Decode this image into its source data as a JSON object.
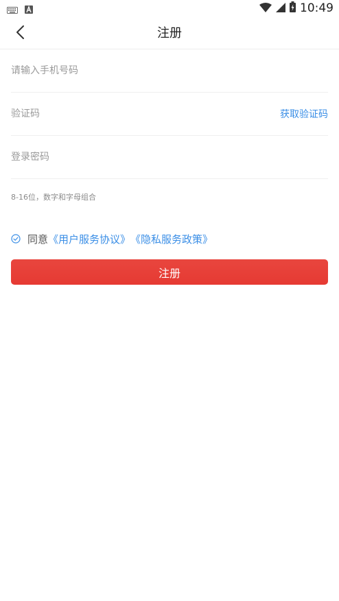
{
  "status_bar": {
    "time": "10:49",
    "icons": [
      "keyboard-icon",
      "a-icon",
      "wifi-icon",
      "signal-icon",
      "battery-icon"
    ]
  },
  "header": {
    "title": "注册",
    "back_icon": "chevron-left-icon"
  },
  "form": {
    "phone_placeholder": "请输入手机号码",
    "phone_value": "",
    "code_placeholder": "验证码",
    "code_value": "",
    "get_code_label": "获取验证码",
    "password_placeholder": "登录密码",
    "password_value": "",
    "password_hint": "8-16位，数字和字母组合"
  },
  "agreement": {
    "checked": true,
    "prefix": "同意",
    "user_agreement": "《用户服务协议》",
    "privacy_policy": "《隐私服务政策》"
  },
  "actions": {
    "register_label": "注册"
  },
  "colors": {
    "accent_blue": "#3a8ee6",
    "button_red": "#e63a33"
  }
}
